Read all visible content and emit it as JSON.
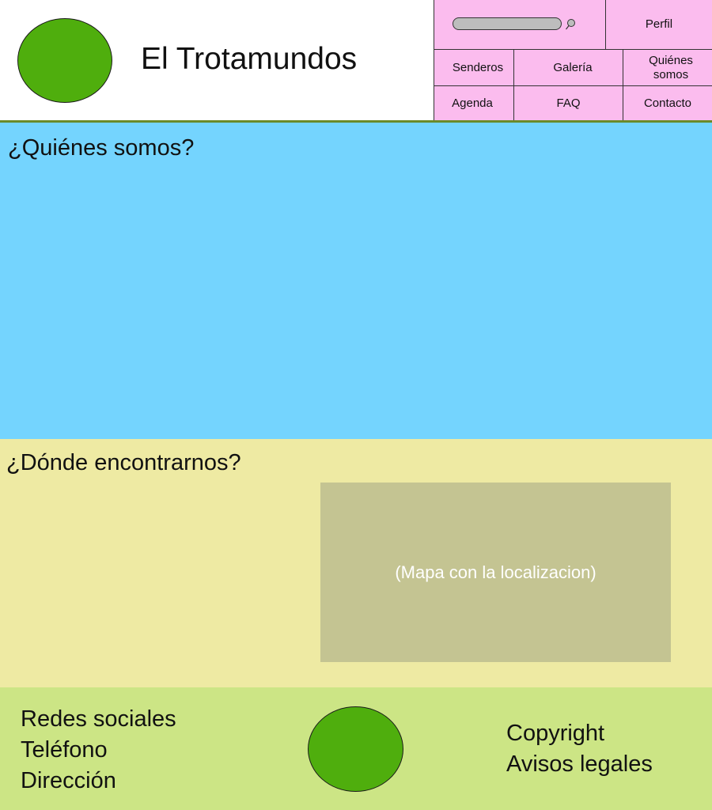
{
  "header": {
    "site_title": "El Trotamundos"
  },
  "nav": {
    "profile_label": "Perfil",
    "search_icon": "search-icon",
    "items": [
      {
        "label": "Senderos"
      },
      {
        "label": "Galería"
      },
      {
        "label": "Quiénes somos"
      },
      {
        "label": "Agenda"
      },
      {
        "label": "FAQ"
      },
      {
        "label": "Contacto"
      }
    ]
  },
  "about": {
    "title": "¿Quiénes somos?"
  },
  "location": {
    "title": "¿Dónde encontrarnos?",
    "map_label": "(Mapa con la localizacion)"
  },
  "footer": {
    "left_links": [
      {
        "label": "Redes sociales"
      },
      {
        "label": "Teléfono"
      },
      {
        "label": "Dirección"
      }
    ],
    "right_links": [
      {
        "label": "Copyright"
      },
      {
        "label": "Avisos legales"
      }
    ]
  },
  "colors": {
    "nav_background": "#fbbcee",
    "about_background": "#74d4fe",
    "location_background": "#eeeaa3",
    "map_background": "#c4c492",
    "footer_background": "#cce585",
    "logo_green": "#4fae0d",
    "header_border": "#6a8a2a"
  }
}
